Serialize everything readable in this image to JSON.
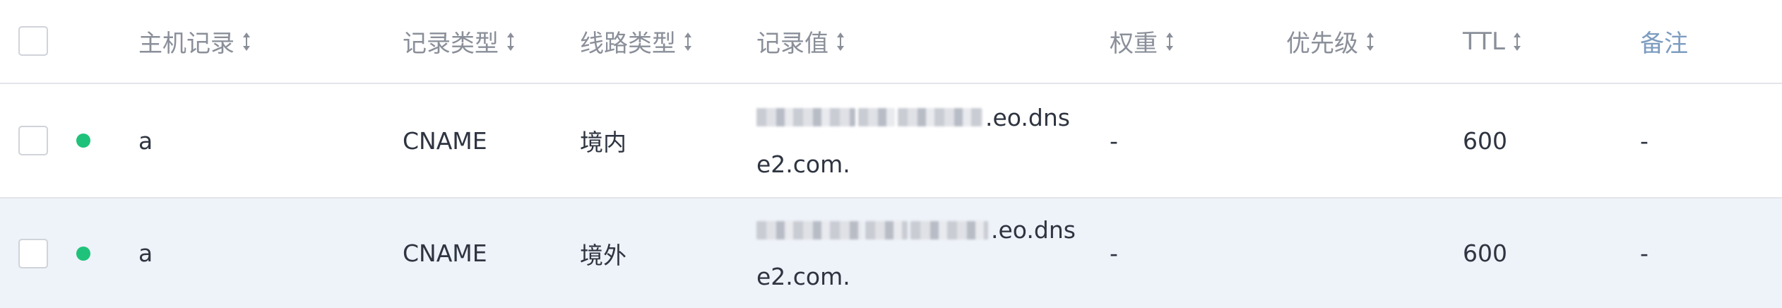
{
  "header": {
    "host_record": "主机记录",
    "record_type": "记录类型",
    "line_type": "线路类型",
    "record_value": "记录值",
    "weight": "权重",
    "priority": "优先级",
    "ttl": "TTL",
    "note": "备注"
  },
  "rows": [
    {
      "status_color": "#1fc27a",
      "host": "a",
      "type": "CNAME",
      "line": "境内",
      "value_line1_suffix": ".eo.dns",
      "value_line2": "e2.com.",
      "weight": "-",
      "ttl": "600",
      "note": "-"
    },
    {
      "status_color": "#1fc27a",
      "host": "a",
      "type": "CNAME",
      "line": "境外",
      "value_line1_suffix": ".eo.dns",
      "value_line2": "e2.com.",
      "weight": "-",
      "ttl": "600",
      "note": "-"
    }
  ],
  "colors": {
    "header_text": "#8a8f99",
    "note_header": "#7d9cc0",
    "body_text": "#2e3440",
    "row_highlight": "#eef2f9",
    "status_active": "#1fc27a"
  }
}
